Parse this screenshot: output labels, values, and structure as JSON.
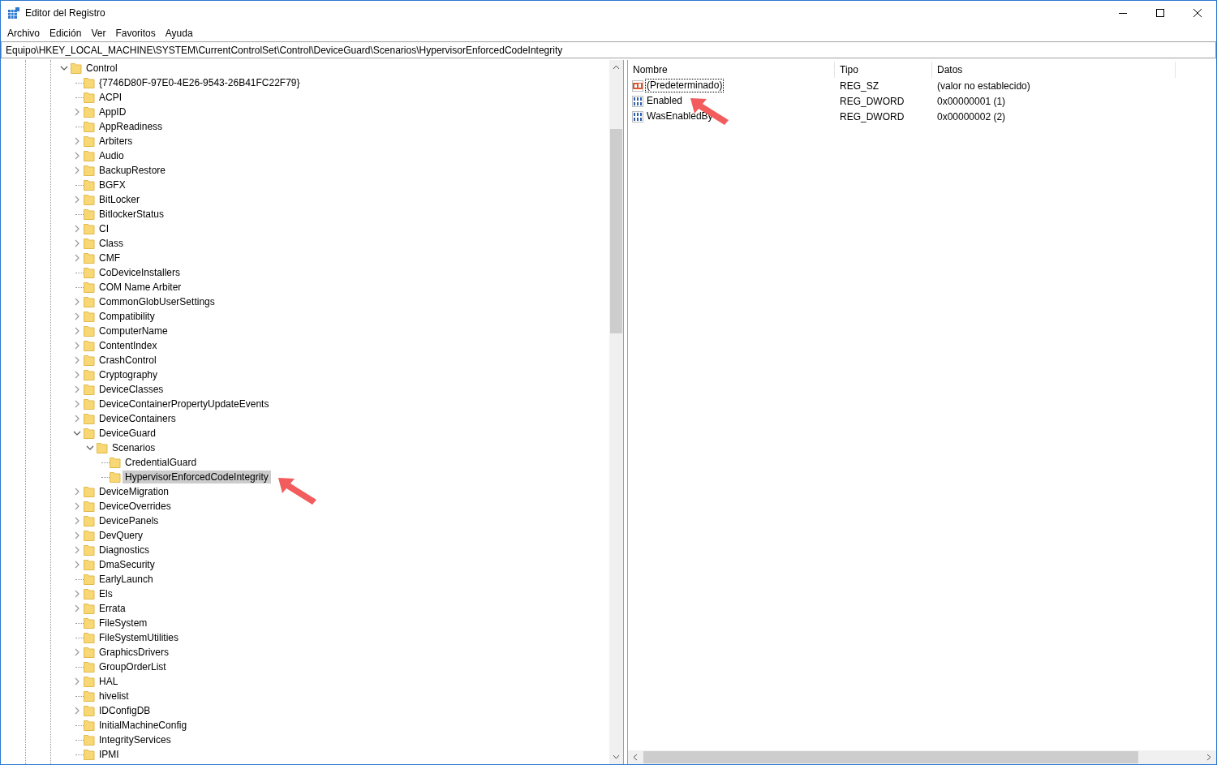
{
  "window": {
    "title": "Editor del Registro"
  },
  "menu": [
    "Archivo",
    "Edición",
    "Ver",
    "Favoritos",
    "Ayuda"
  ],
  "address": "Equipo\\HKEY_LOCAL_MACHINE\\SYSTEM\\CurrentControlSet\\Control\\DeviceGuard\\Scenarios\\HypervisorEnforcedCodeIntegrity",
  "tree": [
    {
      "label": "Control",
      "expandable": true,
      "expanded": true,
      "selected": false,
      "children": [
        {
          "label": "{7746D80F-97E0-4E26-9543-26B41FC22F79}",
          "expandable": false,
          "selected": false
        },
        {
          "label": "ACPI",
          "expandable": false,
          "selected": false
        },
        {
          "label": "AppID",
          "expandable": true,
          "expanded": false,
          "selected": false
        },
        {
          "label": "AppReadiness",
          "expandable": false,
          "selected": false
        },
        {
          "label": "Arbiters",
          "expandable": true,
          "expanded": false,
          "selected": false
        },
        {
          "label": "Audio",
          "expandable": true,
          "expanded": false,
          "selected": false
        },
        {
          "label": "BackupRestore",
          "expandable": true,
          "expanded": false,
          "selected": false
        },
        {
          "label": "BGFX",
          "expandable": false,
          "selected": false
        },
        {
          "label": "BitLocker",
          "expandable": true,
          "expanded": false,
          "selected": false
        },
        {
          "label": "BitlockerStatus",
          "expandable": false,
          "selected": false
        },
        {
          "label": "CI",
          "expandable": true,
          "expanded": false,
          "selected": false
        },
        {
          "label": "Class",
          "expandable": true,
          "expanded": false,
          "selected": false
        },
        {
          "label": "CMF",
          "expandable": true,
          "expanded": false,
          "selected": false
        },
        {
          "label": "CoDeviceInstallers",
          "expandable": false,
          "selected": false
        },
        {
          "label": "COM Name Arbiter",
          "expandable": false,
          "selected": false
        },
        {
          "label": "CommonGlobUserSettings",
          "expandable": true,
          "expanded": false,
          "selected": false
        },
        {
          "label": "Compatibility",
          "expandable": true,
          "expanded": false,
          "selected": false
        },
        {
          "label": "ComputerName",
          "expandable": true,
          "expanded": false,
          "selected": false
        },
        {
          "label": "ContentIndex",
          "expandable": true,
          "expanded": false,
          "selected": false
        },
        {
          "label": "CrashControl",
          "expandable": true,
          "expanded": false,
          "selected": false
        },
        {
          "label": "Cryptography",
          "expandable": true,
          "expanded": false,
          "selected": false
        },
        {
          "label": "DeviceClasses",
          "expandable": true,
          "expanded": false,
          "selected": false
        },
        {
          "label": "DeviceContainerPropertyUpdateEvents",
          "expandable": true,
          "expanded": false,
          "selected": false
        },
        {
          "label": "DeviceContainers",
          "expandable": true,
          "expanded": false,
          "selected": false
        },
        {
          "label": "DeviceGuard",
          "expandable": true,
          "expanded": true,
          "selected": false,
          "children": [
            {
              "label": "Scenarios",
              "expandable": true,
              "expanded": true,
              "selected": false,
              "children": [
                {
                  "label": "CredentialGuard",
                  "expandable": false,
                  "selected": false
                },
                {
                  "label": "HypervisorEnforcedCodeIntegrity",
                  "expandable": false,
                  "selected": true
                }
              ]
            }
          ]
        },
        {
          "label": "DeviceMigration",
          "expandable": true,
          "expanded": false,
          "selected": false
        },
        {
          "label": "DeviceOverrides",
          "expandable": true,
          "expanded": false,
          "selected": false
        },
        {
          "label": "DevicePanels",
          "expandable": true,
          "expanded": false,
          "selected": false
        },
        {
          "label": "DevQuery",
          "expandable": true,
          "expanded": false,
          "selected": false
        },
        {
          "label": "Diagnostics",
          "expandable": true,
          "expanded": false,
          "selected": false
        },
        {
          "label": "DmaSecurity",
          "expandable": true,
          "expanded": false,
          "selected": false
        },
        {
          "label": "EarlyLaunch",
          "expandable": false,
          "selected": false
        },
        {
          "label": "Els",
          "expandable": true,
          "expanded": false,
          "selected": false
        },
        {
          "label": "Errata",
          "expandable": true,
          "expanded": false,
          "selected": false
        },
        {
          "label": "FileSystem",
          "expandable": false,
          "selected": false
        },
        {
          "label": "FileSystemUtilities",
          "expandable": false,
          "selected": false
        },
        {
          "label": "GraphicsDrivers",
          "expandable": true,
          "expanded": false,
          "selected": false
        },
        {
          "label": "GroupOrderList",
          "expandable": false,
          "selected": false
        },
        {
          "label": "HAL",
          "expandable": true,
          "expanded": false,
          "selected": false
        },
        {
          "label": "hivelist",
          "expandable": false,
          "selected": false
        },
        {
          "label": "IDConfigDB",
          "expandable": true,
          "expanded": false,
          "selected": false
        },
        {
          "label": "InitialMachineConfig",
          "expandable": false,
          "selected": false
        },
        {
          "label": "IntegrityServices",
          "expandable": false,
          "selected": false
        },
        {
          "label": "IPMI",
          "expandable": false,
          "selected": false
        }
      ]
    }
  ],
  "values": {
    "columns": [
      "Nombre",
      "Tipo",
      "Datos"
    ],
    "rows": [
      {
        "kind": "string",
        "name": "(Predeterminado)",
        "type": "REG_SZ",
        "data": "(valor no establecido)",
        "focused": true
      },
      {
        "kind": "binary",
        "name": "Enabled",
        "type": "REG_DWORD",
        "data": "0x00000001 (1)",
        "focused": false
      },
      {
        "kind": "binary",
        "name": "WasEnabledBy",
        "type": "REG_DWORD",
        "data": "0x00000002 (2)",
        "focused": false
      }
    ]
  }
}
